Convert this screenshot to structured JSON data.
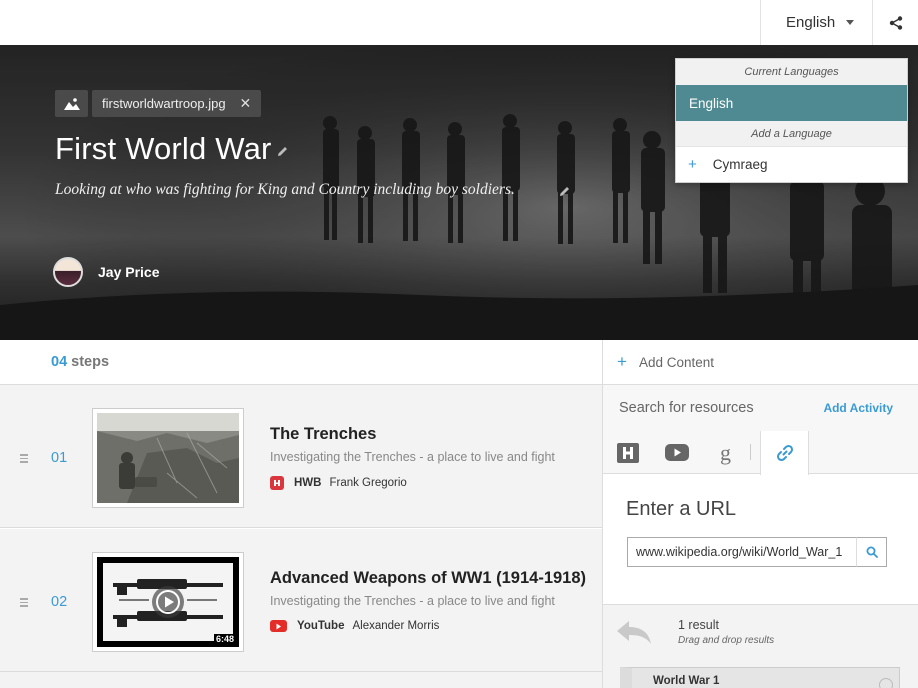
{
  "topbar": {
    "language_label": "English"
  },
  "hero": {
    "file_name": "firstworldwartroop.jpg",
    "title": "First World War",
    "subtitle": "Looking at who was fighting for King and Country including boy soldiers.",
    "author": "Jay Price"
  },
  "language_menu": {
    "current_header": "Current Languages",
    "current": "English",
    "add_header": "Add a Language",
    "add_options": [
      "Cymraeg"
    ],
    "add_option_0": "Cymraeg"
  },
  "steps": {
    "count": "04",
    "label": "steps",
    "items": [
      {
        "number": "01",
        "title": "The Trenches",
        "description": "Investigating the Trenches - a place to live and fight",
        "source": "HWB",
        "author": "Frank Gregorio",
        "source_color": "#d9363e"
      },
      {
        "number": "02",
        "title": "Advanced Weapons of WW1 (1914-1918)",
        "description": "Investigating the Trenches - a place to live and fight",
        "source": "YouTube",
        "author": "Alexander Morris",
        "duration": "6:48",
        "source_color": "#e52d27"
      }
    ]
  },
  "right_panel": {
    "add_content": "Add Content",
    "search_label": "Search for resources",
    "add_activity": "Add Activity",
    "tabs": [
      "hwb-icon",
      "youtube-icon",
      "google-icon",
      "link-icon"
    ],
    "active_tab": "link-icon",
    "url_title": "Enter a URL",
    "url_value": "www.wikipedia.org/wiki/World_War_1",
    "result_count": "1 result",
    "result_hint": "Drag and drop results",
    "result_title": "World War 1"
  },
  "colors": {
    "accent": "#3a9bd3",
    "selected_language": "#4f8a92"
  }
}
